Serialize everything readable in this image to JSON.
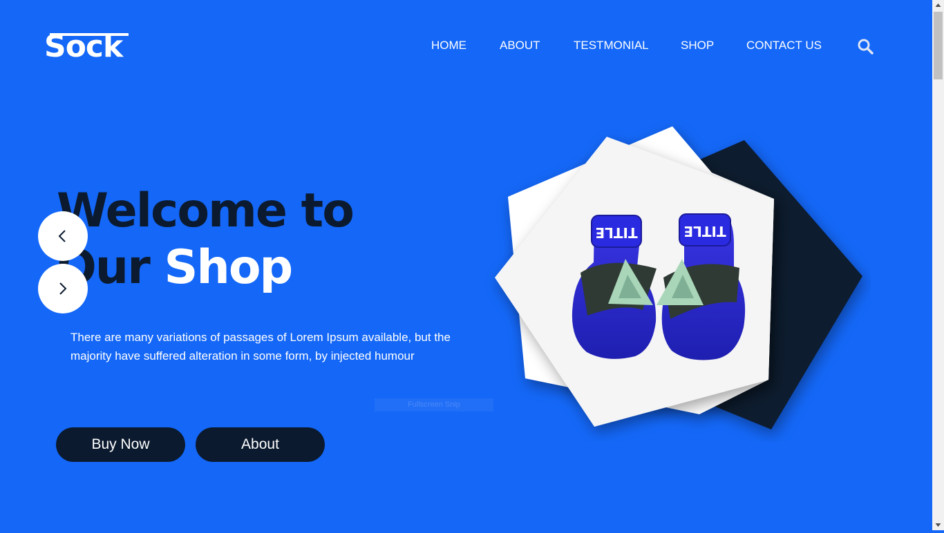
{
  "brand": {
    "logo_text": "Sock"
  },
  "nav": {
    "items": [
      {
        "label": "HOME"
      },
      {
        "label": "ABOUT"
      },
      {
        "label": "TESTMONIAL"
      },
      {
        "label": "SHOP"
      },
      {
        "label": "CONTACT US"
      }
    ],
    "search_icon": "search-icon"
  },
  "hero": {
    "title_line1": "Welcome to",
    "title_line2_dark": "Our",
    "title_line2_light": "Shop",
    "description": "There are many variations of passages of Lorem Ipsum available, but the majority have suffered alteration in some form, by injected humour",
    "faint_tag": "Fullscreen Snip",
    "buttons": {
      "buy": "Buy Now",
      "about": "About"
    },
    "carousel": {
      "prev_icon": "chevron-left-icon",
      "next_icon": "chevron-right-icon"
    },
    "product_image": "boxing-gloves-image",
    "glove_brand_text": "TITLE"
  },
  "colors": {
    "background": "#1467f7",
    "dark": "#0b1a2e",
    "white": "#ffffff",
    "glove_blue": "#2b2bd9"
  }
}
